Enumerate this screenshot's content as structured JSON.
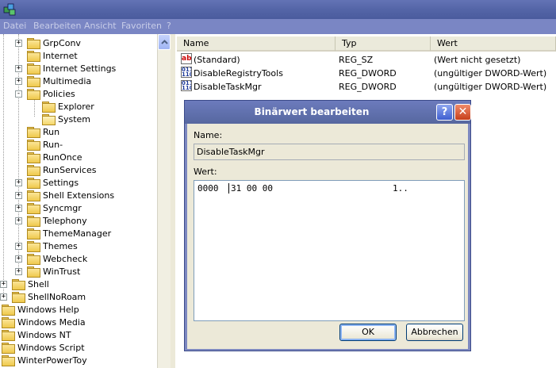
{
  "menu": [
    "Datei",
    "Bearbeiten",
    "Ansicht",
    "Favoriten",
    "?"
  ],
  "tree": [
    {
      "label": "GrpConv",
      "level": 1,
      "expander": "+"
    },
    {
      "label": "Internet",
      "level": 1,
      "expander": ""
    },
    {
      "label": "Internet Settings",
      "level": 1,
      "expander": "+"
    },
    {
      "label": "Multimedia",
      "level": 1,
      "expander": "+"
    },
    {
      "label": "Policies",
      "level": 1,
      "expander": "-"
    },
    {
      "label": "Explorer",
      "level": 2,
      "expander": ""
    },
    {
      "label": "System",
      "level": 2,
      "expander": "",
      "open": true
    },
    {
      "label": "Run",
      "level": 1,
      "expander": ""
    },
    {
      "label": "Run-",
      "level": 1,
      "expander": ""
    },
    {
      "label": "RunOnce",
      "level": 1,
      "expander": ""
    },
    {
      "label": "RunServices",
      "level": 1,
      "expander": ""
    },
    {
      "label": "Settings",
      "level": 1,
      "expander": "+"
    },
    {
      "label": "Shell Extensions",
      "level": 1,
      "expander": "+"
    },
    {
      "label": "Syncmgr",
      "level": 1,
      "expander": "+"
    },
    {
      "label": "Telephony",
      "level": 1,
      "expander": "+"
    },
    {
      "label": "ThemeManager",
      "level": 1,
      "expander": ""
    },
    {
      "label": "Themes",
      "level": 1,
      "expander": "+"
    },
    {
      "label": "Webcheck",
      "level": 1,
      "expander": "+"
    },
    {
      "label": "WinTrust",
      "level": 1,
      "expander": "+"
    },
    {
      "label": "Shell",
      "level": 0,
      "expander": "+"
    },
    {
      "label": "ShellNoRoam",
      "level": 0,
      "expander": "+"
    },
    {
      "label": "Windows Help",
      "level": -1,
      "expander": ""
    },
    {
      "label": "Windows Media",
      "level": -1,
      "expander": ""
    },
    {
      "label": "Windows NT",
      "level": -1,
      "expander": ""
    },
    {
      "label": "Windows Script",
      "level": -1,
      "expander": ""
    },
    {
      "label": "WinterPowerToy",
      "level": -1,
      "expander": ""
    }
  ],
  "list": {
    "columns": [
      "Name",
      "Typ",
      "Wert"
    ],
    "rows": [
      {
        "icon": "string-value-icon",
        "name": "(Standard)",
        "type": "REG_SZ",
        "value": "(Wert nicht gesetzt)"
      },
      {
        "icon": "binary-value-icon",
        "name": "DisableRegistryTools",
        "type": "REG_DWORD",
        "value": "(ungültiger DWORD-Wert)"
      },
      {
        "icon": "binary-value-icon",
        "name": "DisableTaskMgr",
        "type": "REG_DWORD",
        "value": "(ungültiger DWORD-Wert)"
      }
    ]
  },
  "dialog": {
    "title": "Binärwert bearbeiten",
    "help": "?",
    "close": "✕",
    "name_label": "Name:",
    "name_value": "DisableTaskMgr",
    "value_label": "Wert:",
    "hex_offset": "0000",
    "hex_bytes": "31 00 00",
    "hex_ascii": "1..",
    "ok_label": "OK",
    "cancel_label": "Abbrechen"
  }
}
